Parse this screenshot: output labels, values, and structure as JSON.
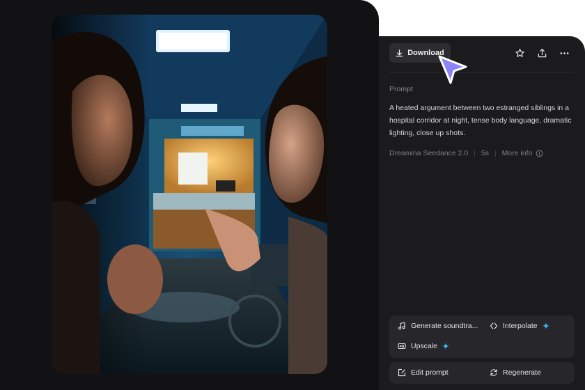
{
  "toolbar": {
    "download_label": "Download",
    "icons": [
      "download-icon",
      "star-icon",
      "share-icon",
      "more-icon"
    ]
  },
  "prompt": {
    "label": "Prompt",
    "text": "A heated argument between two estranged siblings in a hospital corridor at night, tense body language, dramatic lighting, close up shots."
  },
  "meta": {
    "model": "Dreamina Seedance 2.0",
    "duration": "5s",
    "more_info": "More info"
  },
  "actions": {
    "soundtrack": "Generate soundtra...",
    "interpolate": "Interpolate",
    "upscale": "Upscale",
    "edit_prompt": "Edit prompt",
    "regenerate": "Regenerate"
  },
  "colors": {
    "panel_bg": "#1b1b1e",
    "canvas_bg": "#121214",
    "sparkle": "#39b9f2",
    "cursor": "#8b83f7"
  }
}
